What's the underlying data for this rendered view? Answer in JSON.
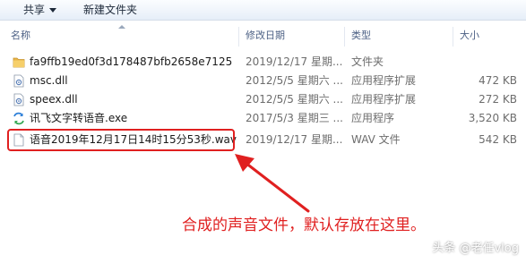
{
  "toolbar": {
    "share_label": "共享",
    "new_folder_label": "新建文件夹"
  },
  "columns": {
    "name": "名称",
    "modified": "修改日期",
    "type": "类型",
    "size": "大小"
  },
  "files": [
    {
      "name": "fa9ffb19ed0f3d178487bfb2658e7125",
      "modified": "2019/12/17 星期...",
      "type": "文件夹",
      "size": "",
      "icon": "folder-icon"
    },
    {
      "name": "msc.dll",
      "modified": "2012/5/5 星期六 ...",
      "type": "应用程序扩展",
      "size": "472 KB",
      "icon": "dll-file-icon"
    },
    {
      "name": "speex.dll",
      "modified": "2012/5/5 星期六 ...",
      "type": "应用程序扩展",
      "size": "272 KB",
      "icon": "dll-file-icon"
    },
    {
      "name": "讯飞文字转语音.exe",
      "modified": "2017/5/3 星期三 ...",
      "type": "应用程序",
      "size": "3,520 KB",
      "icon": "exe-app-icon"
    },
    {
      "name": "语音2019年12月17日14时15分53秒.wav",
      "modified": "2019/12/17 星期...",
      "type": "WAV 文件",
      "size": "542 KB",
      "icon": "wav-file-icon"
    }
  ],
  "annotation": "合成的声音文件，默认存放在这里。",
  "watermark": {
    "platform": "头条",
    "author": "@老任vlog"
  },
  "colors": {
    "highlight": "#e02020",
    "header_text": "#4d6185"
  }
}
